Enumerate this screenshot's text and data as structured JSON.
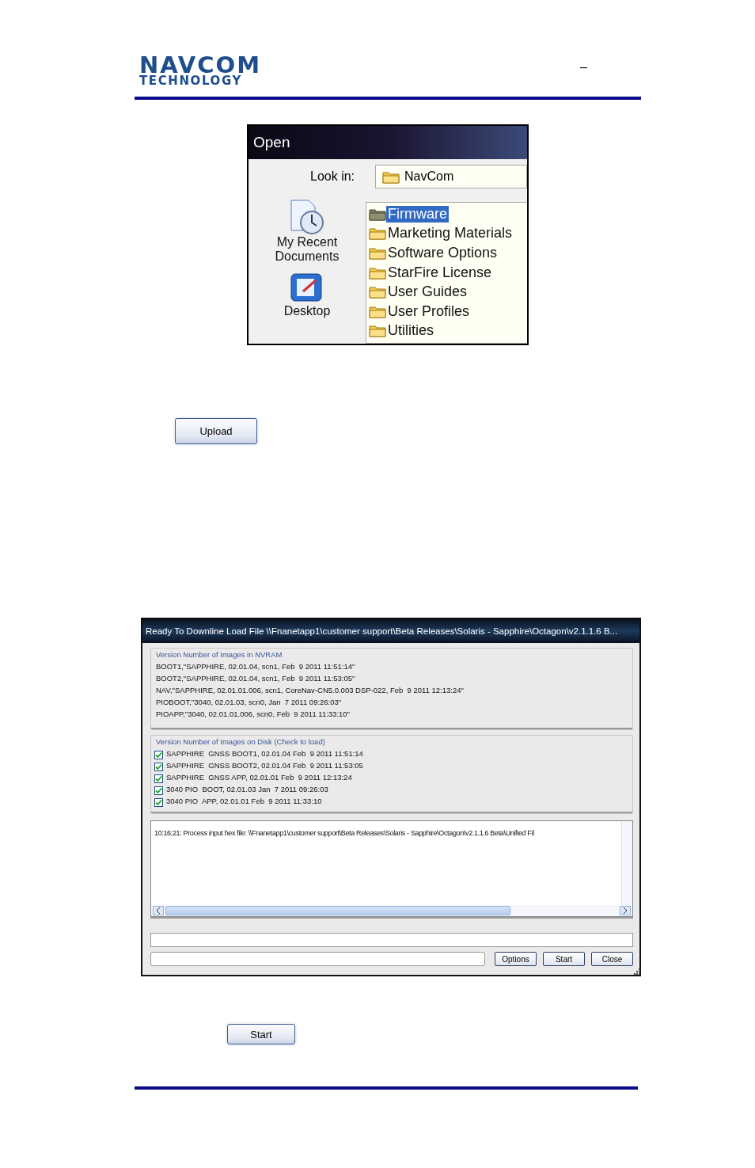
{
  "header": {
    "logo": {
      "line_1": "NAVCOM",
      "line_2": "TECHNOLOGY"
    },
    "mark": "–"
  },
  "open_dialog": {
    "title": "Open",
    "look_in_label": "Look in:",
    "look_in_value": "NavCom",
    "places": [
      {
        "label": "My Recent Documents",
        "kind": "recent"
      },
      {
        "label": "Desktop",
        "kind": "desktop"
      }
    ],
    "folders": [
      {
        "name": "Firmware",
        "selected": true
      },
      {
        "name": "Marketing Materials",
        "selected": false
      },
      {
        "name": "Software Options",
        "selected": false
      },
      {
        "name": "StarFire License",
        "selected": false
      },
      {
        "name": "User Guides",
        "selected": false
      },
      {
        "name": "User Profiles",
        "selected": false
      },
      {
        "name": "Utilities",
        "selected": false
      }
    ]
  },
  "upload_button": "Upload",
  "load_dialog": {
    "title": "Ready To Downline Load File \\\\Fnanetapp1\\customer support\\Beta Releases\\Solaris - Sapphire\\Octagon\\v2.1.1.6 B...",
    "nvram": {
      "legend": "Version Number of Images in NVRAM",
      "lines": [
        "BOOT1,\"SAPPHIRE, 02.01.04, scn1, Feb  9 2011 11:51:14\"",
        "BOOT2,\"SAPPHIRE, 02.01.04, scn1, Feb  9 2011 11:53:05\"",
        "NAV,\"SAPPHIRE, 02.01.01.006, scn1, CoreNav-CN5.0.003 DSP-022, Feb  9 2011 12:13:24\"",
        "PIOBOOT,\"3040, 02.01.03, scn0, Jan  7 2011 09:26:03\"",
        "PIOAPP,\"3040, 02.01.01.006, scn0, Feb  9 2011 11:33:10\""
      ]
    },
    "disk": {
      "legend": "Version Number of Images on Disk (Check to load)",
      "items": [
        {
          "label": "SAPPHIRE  GNSS BOOT1, 02.01.04 Feb  9 2011 11:51:14",
          "checked": true
        },
        {
          "label": "SAPPHIRE  GNSS BOOT2, 02.01.04 Feb  9 2011 11:53:05",
          "checked": true
        },
        {
          "label": "SAPPHIRE  GNSS APP, 02.01.01 Feb  9 2011 12:13:24",
          "checked": true
        },
        {
          "label": "3040 PIO  BOOT, 02.01.03 Jan  7 2011 09:26:03",
          "checked": true
        },
        {
          "label": "3040 PIO  APP, 02.01.01 Feb  9 2011 11:33:10",
          "checked": true
        }
      ]
    },
    "log": [
      "10:16:21: Process input hex file: \\\\Fnanetapp1\\customer support\\Beta Releases\\Solaris - Sapphire\\Octagon\\v2.1.1.6 Beta\\Unified Fil"
    ],
    "buttons": [
      "Options",
      "Start",
      "Close"
    ]
  },
  "start_button": "Start"
}
